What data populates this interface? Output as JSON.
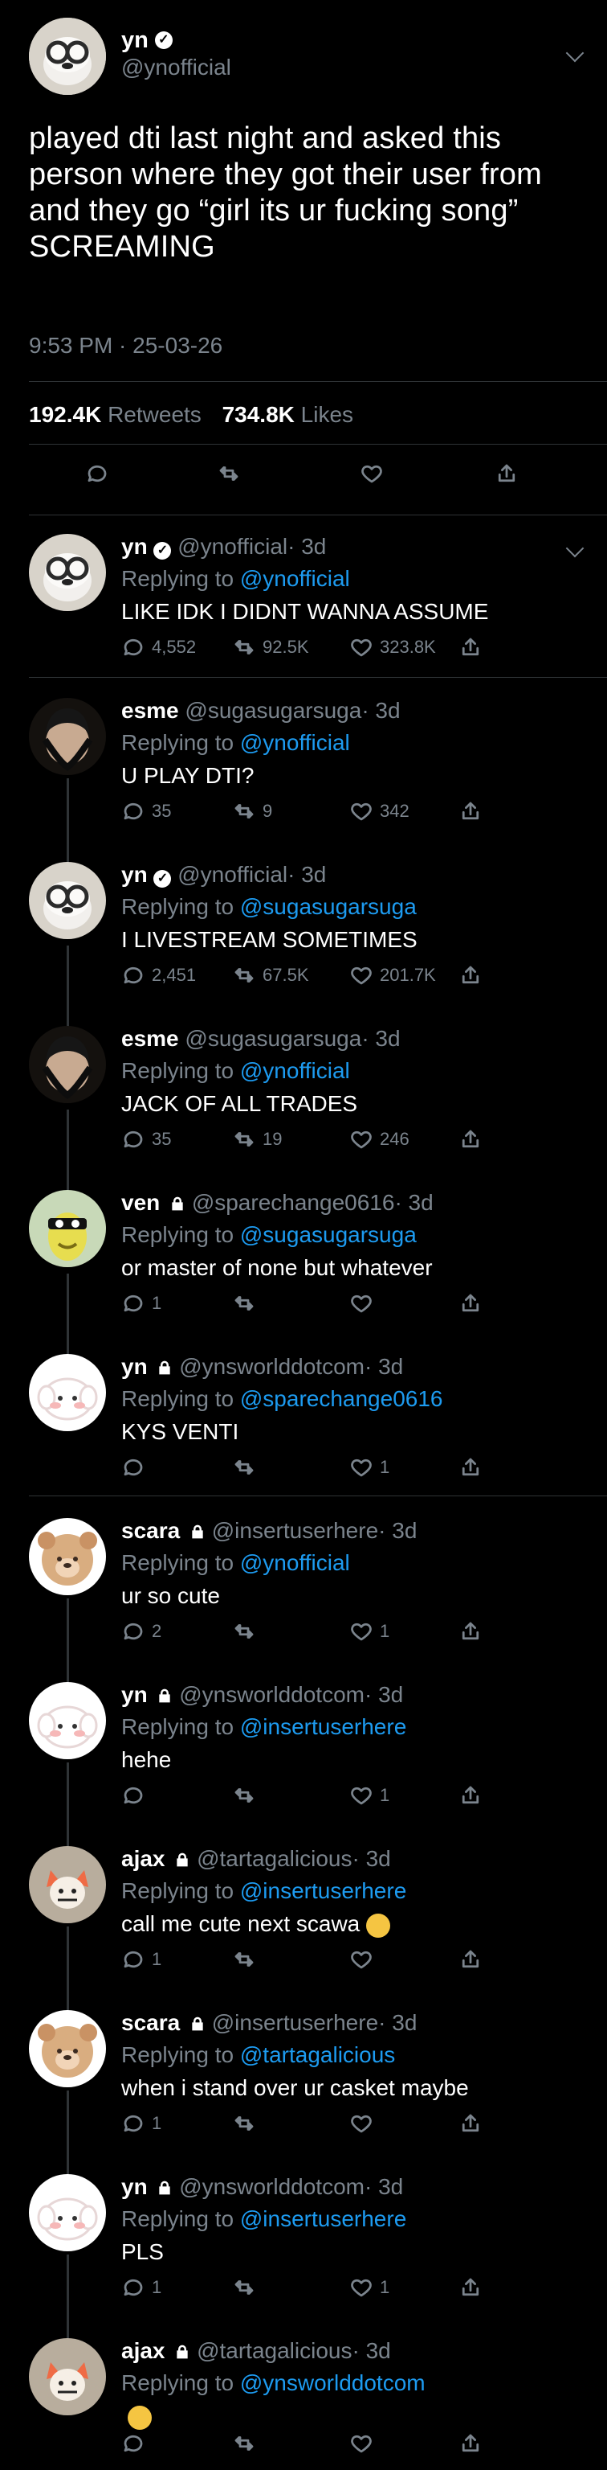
{
  "main": {
    "name": "yn",
    "handle": "@ynofficial",
    "text": "played dti last night and asked this person where they got their user from and they go “girl its ur fucking song” SCREAMING",
    "time": "9:53 PM · 25-03-26",
    "retweets": "192.4K",
    "retweets_label": "Retweets",
    "likes": "734.8K",
    "likes_label": "Likes"
  },
  "replies": [
    {
      "name": "yn",
      "handle": "@ynofficial",
      "time": "· 3d",
      "replying_prefix": "Replying to",
      "replying_to": "@ynofficial",
      "text": "LIKE IDK I DIDNT WANNA ASSUME",
      "replies": "4,552",
      "retweets": "92.5K",
      "likes": "323.8K"
    },
    {
      "name": "esme",
      "handle": "@sugasugarsuga",
      "time": "· 3d",
      "replying_prefix": "Replying to",
      "replying_to": "@ynofficial",
      "text": "U PLAY DTI?",
      "replies": "35",
      "retweets": "9",
      "likes": "342"
    },
    {
      "name": "yn",
      "handle": "@ynofficial",
      "time": "· 3d",
      "replying_prefix": "Replying to",
      "replying_to": "@sugasugarsuga",
      "text": "I LIVESTREAM SOMETIMES",
      "replies": "2,451",
      "retweets": "67.5K",
      "likes": "201.7K"
    },
    {
      "name": "esme",
      "handle": "@sugasugarsuga",
      "time": "· 3d",
      "replying_prefix": "Replying to",
      "replying_to": "@ynofficial",
      "text": "JACK OF ALL TRADES",
      "replies": "35",
      "retweets": "19",
      "likes": "246"
    },
    {
      "name": "ven",
      "handle": "@sparechange0616",
      "time": "· 3d",
      "replying_prefix": "Replying to",
      "replying_to": "@sugasugarsuga",
      "text": "or master of none but whatever",
      "replies": "1",
      "retweets": "",
      "likes": ""
    },
    {
      "name": "yn",
      "handle": "@ynsworlddotcom",
      "time": "· 3d",
      "replying_prefix": "Replying to",
      "replying_to": "@sparechange0616",
      "text": "KYS VENTI",
      "replies": "",
      "retweets": "",
      "likes": "1"
    },
    {
      "name": "scara",
      "handle": "@insertuserhere",
      "time": "· 3d",
      "replying_prefix": "Replying to",
      "replying_to": "@ynofficial",
      "text": "ur so cute",
      "replies": "2",
      "retweets": "",
      "likes": "1"
    },
    {
      "name": "yn",
      "handle": "@ynsworlddotcom",
      "time": "· 3d",
      "replying_prefix": "Replying to",
      "replying_to": "@insertuserhere",
      "text": "hehe",
      "replies": "",
      "retweets": "",
      "likes": "1"
    },
    {
      "name": "ajax",
      "handle": "@tartagalicious",
      "time": "· 3d",
      "replying_prefix": "Replying to",
      "replying_to": "@insertuserhere",
      "text": "call me cute next scawa",
      "replies": "1",
      "retweets": "",
      "likes": ""
    },
    {
      "name": "scara",
      "handle": "@insertuserhere",
      "time": "· 3d",
      "replying_prefix": "Replying to",
      "replying_to": "@tartagalicious",
      "text": "when i stand over ur casket maybe",
      "replies": "1",
      "retweets": "",
      "likes": ""
    },
    {
      "name": "yn",
      "handle": "@ynsworlddotcom",
      "time": "· 3d",
      "replying_prefix": "Replying to",
      "replying_to": "@insertuserhere",
      "text": "PLS",
      "replies": "1",
      "retweets": "",
      "likes": "1"
    },
    {
      "name": "ajax",
      "handle": "@tartagalicious",
      "time": "· 3d",
      "replying_prefix": "Replying to",
      "replying_to": "@ynsworlddotcom",
      "text": "",
      "replies": "",
      "retweets": "",
      "likes": ""
    }
  ]
}
